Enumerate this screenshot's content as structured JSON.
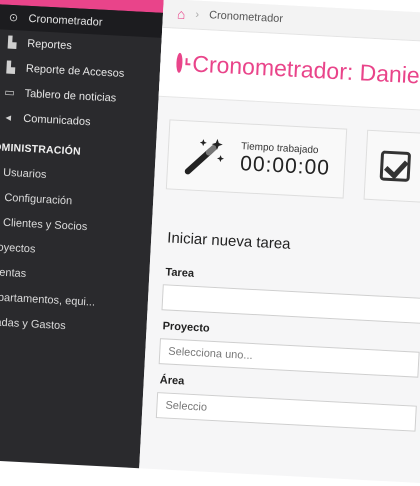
{
  "sidebar": {
    "items": [
      {
        "label": "Cronometrador",
        "icon": "clock-icon"
      },
      {
        "label": "Reportes",
        "icon": "chart-icon"
      },
      {
        "label": "Reporte de Accesos",
        "icon": "chart-icon"
      },
      {
        "label": "Tablero de noticias",
        "icon": "board-icon"
      },
      {
        "label": "Comunicados",
        "icon": "megaphone-icon"
      }
    ],
    "section_title": "DMINISTRACIÓN",
    "admin_items": [
      {
        "label": "Usuarios",
        "icon": "users-icon"
      },
      {
        "label": "Configuración",
        "icon": "gear-icon"
      },
      {
        "label": "Clientes y Socios",
        "icon": "clients-icon"
      },
      {
        "label": "Proyectos",
        "icon": ""
      },
      {
        "label": "Cuentas",
        "icon": ""
      },
      {
        "label": "Departamentos, equi...",
        "icon": ""
      },
      {
        "label": "ntradas y Gastos",
        "icon": ""
      }
    ]
  },
  "breadcrumb": {
    "current": "Cronometrador"
  },
  "page": {
    "title": "Cronometrador: Daniel Mu"
  },
  "cards": {
    "time_label": "Tiempo trabajado",
    "time_value": "00:00:00"
  },
  "form": {
    "section_title": "Iniciar nueva tarea",
    "task_label": "Tarea",
    "task_value": "",
    "project_label": "Proyecto",
    "project_placeholder": "Selecciona uno...",
    "area_label": "Área",
    "area_placeholder": "Seleccio"
  },
  "colors": {
    "accent": "#e9448a",
    "sidebar_bg": "#2a2a2d"
  }
}
